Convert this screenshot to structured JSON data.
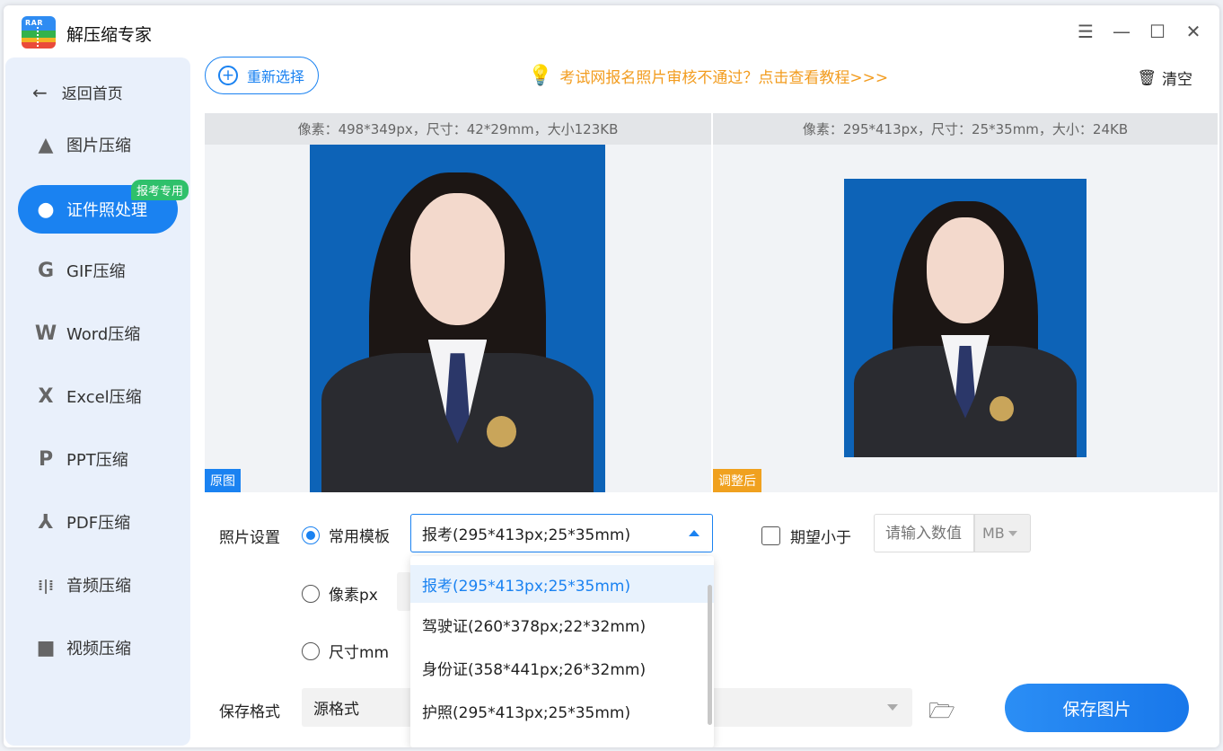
{
  "app": {
    "title": "解压缩专家",
    "logo_text": "RAR"
  },
  "window_controls": {
    "menu": "☰",
    "minimize": "—",
    "maximize": "☐",
    "close": "✕"
  },
  "sidebar": {
    "back_label": "返回首页",
    "badge": "报考专用",
    "items": [
      {
        "label": "图片压缩",
        "icon": "▲"
      },
      {
        "label": "证件照处理",
        "icon": "●"
      },
      {
        "label": "GIF压缩",
        "icon": "G"
      },
      {
        "label": "Word压缩",
        "icon": "W"
      },
      {
        "label": "Excel压缩",
        "icon": "X"
      },
      {
        "label": "PPT压缩",
        "icon": "P"
      },
      {
        "label": "PDF压缩",
        "icon": "⅄"
      },
      {
        "label": "音频压缩",
        "icon": "⁞|⁞"
      },
      {
        "label": "视频压缩",
        "icon": "■"
      }
    ]
  },
  "toolbar": {
    "reselect_label": "重新选择",
    "tip": "考试网报名照片审核不通过？点击查看教程>>>",
    "clear_label": "清空"
  },
  "preview": {
    "original_info": "像素：498*349px，尺寸：42*29mm，大小123KB",
    "adjusted_info": "像素：295*413px，尺寸：25*35mm，大小：24KB",
    "original_tag": "原图",
    "adjusted_tag": "调整后"
  },
  "settings": {
    "photo_settings_label": "照片设置",
    "template_label": "常用模板",
    "pixel_label": "像素px",
    "size_label": "尺寸mm",
    "selected_template": "报考(295*413px;25*35mm)",
    "template_options": [
      "报考(295*413px;25*35mm)",
      "驾驶证(260*378px;22*32mm)",
      "身份证(358*441px;26*32mm)",
      "护照(295*413px;25*35mm)"
    ],
    "expect_less_label": "期望小于",
    "value_placeholder": "请输入数值",
    "unit": "MB",
    "save_format_label": "保存格式",
    "format_value": "源格式",
    "save_button": "保存图片"
  },
  "colors": {
    "accent": "#1a82f1",
    "tip": "#f29c1f",
    "badge": "#2fc06b",
    "photo_bg": "#0d63b7"
  }
}
